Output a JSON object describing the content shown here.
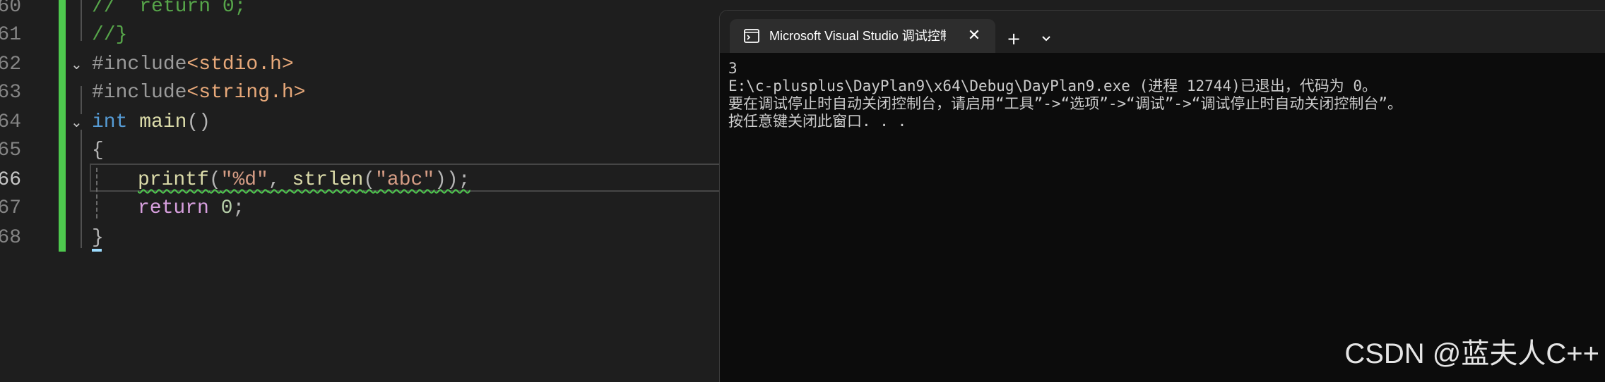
{
  "editor": {
    "lines": [
      {
        "number": "60",
        "tokens": [
          {
            "t": "//  return 0;",
            "c": "comment"
          }
        ]
      },
      {
        "number": "61",
        "tokens": [
          {
            "t": "//}",
            "c": "comment"
          }
        ]
      },
      {
        "number": "62",
        "tokens": [
          {
            "t": "#include",
            "c": "pp"
          },
          {
            "t": "<stdio.h>",
            "c": "inc"
          }
        ]
      },
      {
        "number": "63",
        "tokens": [
          {
            "t": "#include",
            "c": "pp"
          },
          {
            "t": "<string.h>",
            "c": "inc"
          }
        ]
      },
      {
        "number": "64",
        "tokens": [
          {
            "t": "int",
            "c": "kw"
          },
          {
            "t": " ",
            "c": "plain"
          },
          {
            "t": "main",
            "c": "fn"
          },
          {
            "t": "()",
            "c": "punc"
          }
        ]
      },
      {
        "number": "65",
        "tokens": [
          {
            "t": "{",
            "c": "punc"
          }
        ]
      },
      {
        "number": "66",
        "tokens": [
          {
            "t": "printf",
            "c": "fn"
          },
          {
            "t": "(",
            "c": "punc"
          },
          {
            "t": "\"%d\"",
            "c": "str"
          },
          {
            "t": ", ",
            "c": "punc"
          },
          {
            "t": "strlen",
            "c": "fn"
          },
          {
            "t": "(",
            "c": "punc"
          },
          {
            "t": "\"abc\"",
            "c": "str"
          },
          {
            "t": "));",
            "c": "punc"
          }
        ]
      },
      {
        "number": "67",
        "tokens": [
          {
            "t": "return",
            "c": "kwctl"
          },
          {
            "t": " ",
            "c": "plain"
          },
          {
            "t": "0",
            "c": "num"
          },
          {
            "t": ";",
            "c": "punc"
          }
        ]
      },
      {
        "number": "68",
        "tokens": [
          {
            "t": "}",
            "c": "punc"
          }
        ]
      }
    ],
    "active_line": "66"
  },
  "terminal": {
    "tab_title": "Microsoft Visual Studio 调试控制台",
    "icon": "console-icon",
    "close_icon": "close-icon",
    "new_tab_label": "+",
    "dropdown_icon": "chevron-down-icon",
    "output": [
      "3",
      "E:\\c-plusplus\\DayPlan9\\x64\\Debug\\DayPlan9.exe (进程 12744)已退出，代码为 0。",
      "要在调试停止时自动关闭控制台，请启用“工具”->“选项”->“调试”->“调试停止时自动关闭控制台”。",
      "按任意键关闭此窗口. . ."
    ]
  },
  "watermark": "CSDN @蓝夫人C++",
  "colors": {
    "editor_bg": "#1e1e1e",
    "terminal_bg": "#0c0c0c",
    "change_bar": "#4ec94e",
    "comment": "#57a64a",
    "keyword": "#569cd6",
    "string": "#d69d85",
    "function": "#dcdcaa"
  }
}
